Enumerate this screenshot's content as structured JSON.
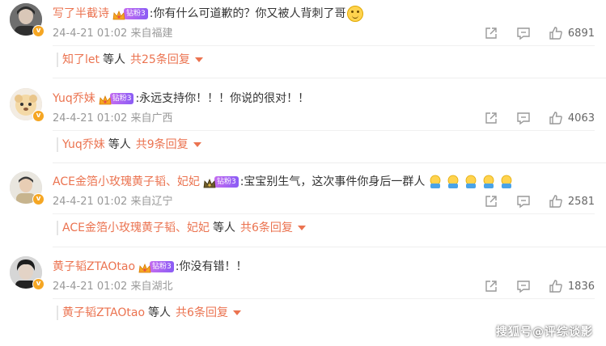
{
  "colors": {
    "username": "#eb7350",
    "meta": "#999999",
    "badge": "#a064f2"
  },
  "comments": [
    {
      "username": "写了半截诗",
      "badge": "钻粉3",
      "text": ":你有什么可道歉的？你又被人背刺了哥",
      "emoji": "smile-emoji",
      "time": "24-4-21 01:02",
      "location": "来自福建",
      "likes": "6891",
      "reply_user": "知了let",
      "reply_mid": "等人",
      "reply_count": "共25条回复"
    },
    {
      "username": "Yuq乔妹",
      "badge": "钻粉3",
      "text": ":永远支持你！！！你说的很对！！",
      "time": "24-4-21 01:02",
      "location": "来自广西",
      "likes": "4063",
      "reply_user": "Yuq乔妹",
      "reply_mid": "等人",
      "reply_count": "共9条回复"
    },
    {
      "username": "ACE金箔小玫瑰黄子韬、妃妃",
      "badge": "钻粉3",
      "text": ":宝宝别生气，这次事件你身后一群人",
      "emoji": "hug-emoji",
      "time": "24-4-21 01:02",
      "location": "来自辽宁",
      "likes": "2581",
      "reply_user": "ACE金箔小玫瑰黄子韬、妃妃",
      "reply_mid": "等人",
      "reply_count": "共6条回复"
    },
    {
      "username": "黄子韬ZTAOtao",
      "badge": "钻粉3",
      "text": ":你没有错！！",
      "time": "24-4-21 01:02",
      "location": "来自湖北",
      "likes": "1836",
      "reply_user": "黄子韬ZTAOtao",
      "reply_mid": "等人",
      "reply_count": "共6条回复"
    }
  ],
  "watermark": "搜狐号@评综谈影"
}
